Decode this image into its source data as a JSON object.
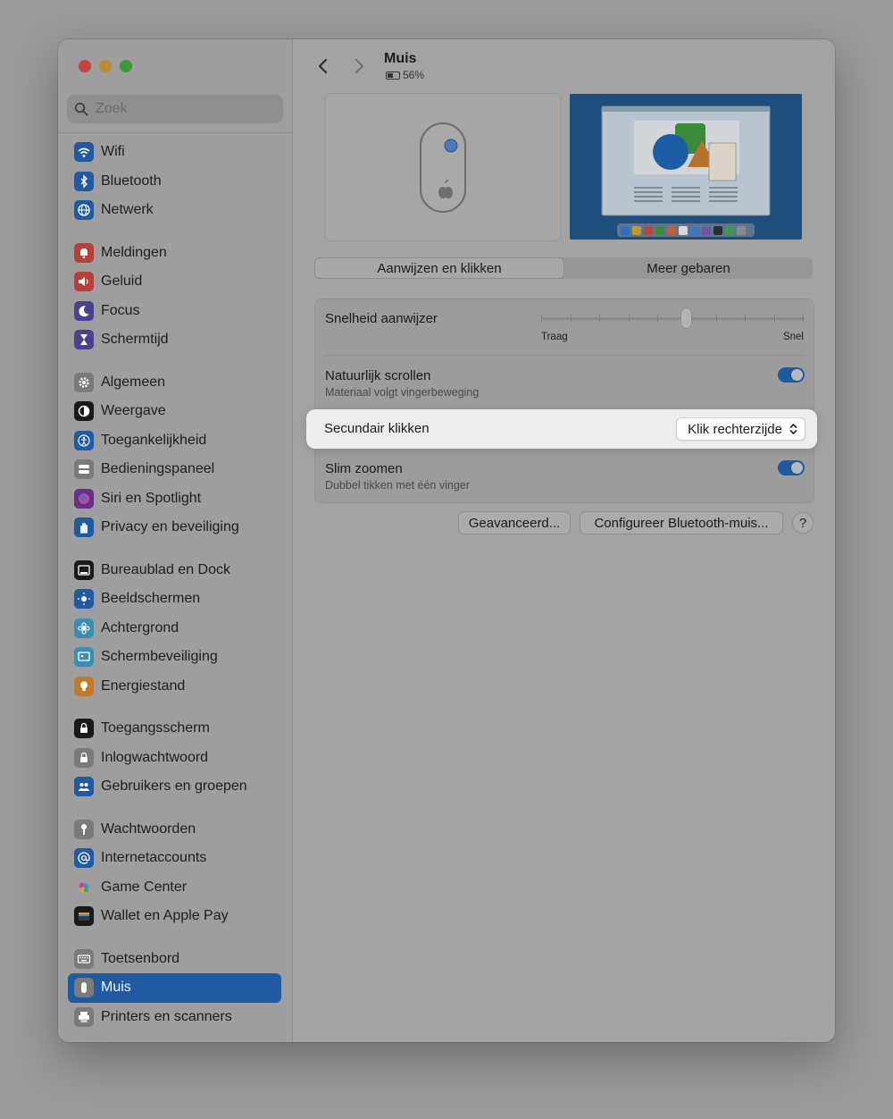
{
  "window": {
    "title": "Muis",
    "battery": "56%"
  },
  "search": {
    "placeholder": "Zoek"
  },
  "sidebar": {
    "groups": [
      {
        "items": [
          {
            "label": "Wifi",
            "icon": "wifi-icon",
            "color": "#1f5aa3"
          },
          {
            "label": "Bluetooth",
            "icon": "bluetooth-icon",
            "color": "#1f5aa3"
          },
          {
            "label": "Netwerk",
            "icon": "globe-icon",
            "color": "#1f5aa3"
          }
        ]
      },
      {
        "items": [
          {
            "label": "Meldingen",
            "icon": "bell-icon",
            "color": "#b8403b"
          },
          {
            "label": "Geluid",
            "icon": "speaker-icon",
            "color": "#b8403b"
          },
          {
            "label": "Focus",
            "icon": "moon-icon",
            "color": "#4b3f8f"
          },
          {
            "label": "Schermtijd",
            "icon": "hourglass-icon",
            "color": "#4b3f8f"
          }
        ]
      },
      {
        "items": [
          {
            "label": "Algemeen",
            "icon": "gear-icon",
            "color": "#7a7a7a"
          },
          {
            "label": "Weergave",
            "icon": "appearance-icon",
            "color": "#1a1a1a"
          },
          {
            "label": "Toegankelijkheid",
            "icon": "accessibility-icon",
            "color": "#1f5aa3"
          },
          {
            "label": "Bedieningspaneel",
            "icon": "control-center-icon",
            "color": "#7a7a7a"
          },
          {
            "label": "Siri en Spotlight",
            "icon": "siri-icon",
            "color": "#6a2f8a"
          },
          {
            "label": "Privacy en beveiliging",
            "icon": "hand-icon",
            "color": "#1f5aa3"
          }
        ]
      },
      {
        "items": [
          {
            "label": "Bureaublad en Dock",
            "icon": "dock-icon",
            "color": "#1a1a1a"
          },
          {
            "label": "Beeldschermen",
            "icon": "sun-icon",
            "color": "#1f5aa3"
          },
          {
            "label": "Achtergrond",
            "icon": "flower-icon",
            "color": "#3a8fb0"
          },
          {
            "label": "Schermbeveiliging",
            "icon": "screensaver-icon",
            "color": "#3a8fb0"
          },
          {
            "label": "Energiestand",
            "icon": "bulb-icon",
            "color": "#c27a2a"
          }
        ]
      },
      {
        "items": [
          {
            "label": "Toegangsscherm",
            "icon": "lock-screen-icon",
            "color": "#1a1a1a"
          },
          {
            "label": "Inlogwachtwoord",
            "icon": "lock-icon",
            "color": "#7a7a7a"
          },
          {
            "label": "Gebruikers en groepen",
            "icon": "users-icon",
            "color": "#1f5aa3"
          }
        ]
      },
      {
        "items": [
          {
            "label": "Wachtwoorden",
            "icon": "key-icon",
            "color": "#7a7a7a"
          },
          {
            "label": "Internetaccounts",
            "icon": "at-icon",
            "color": "#1f5aa3"
          },
          {
            "label": "Game Center",
            "icon": "game-center-icon",
            "color": "#9e9e9e"
          },
          {
            "label": "Wallet en Apple Pay",
            "icon": "wallet-icon",
            "color": "#1a1a1a"
          }
        ]
      },
      {
        "items": [
          {
            "label": "Toetsenbord",
            "icon": "keyboard-icon",
            "color": "#7a7a7a"
          },
          {
            "label": "Muis",
            "icon": "mouse-icon",
            "color": "#7a7a7a",
            "selected": true
          },
          {
            "label": "Printers en scanners",
            "icon": "printer-icon",
            "color": "#7a7a7a"
          }
        ]
      }
    ]
  },
  "tabs": [
    {
      "label": "Aanwijzen en klikken",
      "active": true
    },
    {
      "label": "Meer gebaren",
      "active": false
    }
  ],
  "settings": {
    "speed": {
      "label": "Snelheid aanwijzer",
      "min_label": "Traag",
      "max_label": "Snel",
      "value_fraction": 0.55
    },
    "natural_scroll": {
      "label": "Natuurlijk scrollen",
      "sub": "Materiaal volgt vingerbeweging",
      "on": true
    },
    "secondary_click": {
      "label": "Secundair klikken",
      "value": "Klik rechterzijde"
    },
    "smart_zoom": {
      "label": "Slim zoomen",
      "sub": "Dubbel tikken met één vinger",
      "on": true
    }
  },
  "buttons": {
    "advanced": "Geavanceerd...",
    "configure": "Configureer Bluetooth-muis...",
    "help": "?"
  }
}
